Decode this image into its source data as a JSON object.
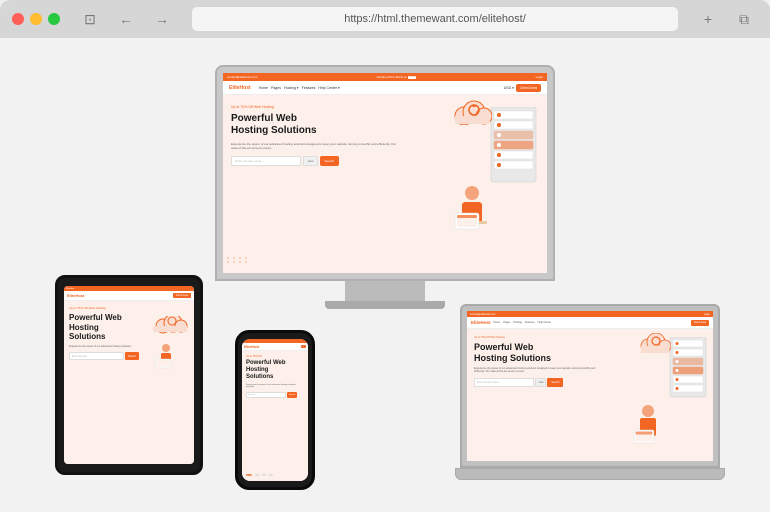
{
  "browser": {
    "url": "https://html.themewant.com/elitehost/",
    "back_label": "←",
    "forward_label": "→",
    "add_tab_label": "+",
    "duplicate_tab_label": "⧉",
    "sidebar_label": "⊡"
  },
  "site": {
    "topbar_text_left": "contact@elitehost.com",
    "topbar_text_middle": "Hosting Price Starts at",
    "topbar_badge": "$2.99",
    "topbar_right": "customercare",
    "login_label": "Login",
    "logo": "EliteHost",
    "nav_items": [
      "Home",
      "Pages",
      "Hosting",
      "Features",
      "Help Center"
    ],
    "nav_dropdown_label": "USD",
    "nav_cta": "Client Area",
    "hero_tag": "Up to 75% Off Web Hosting",
    "hero_title_line1": "Powerful Web",
    "hero_title_line2": "Hosting Solutions",
    "hero_desc": "Experience the power of our advanced hosting solutions designed to keep your website running smoothly and efficiently. Our state-of-the-art servers ensure",
    "search_placeholder": "Enter domain name...",
    "search_dropdown": ".com",
    "search_btn": "Search"
  },
  "devices": {
    "monitor_label": "Desktop Monitor",
    "tablet_label": "Tablet",
    "phone_label": "Mobile Phone",
    "laptop_label": "Laptop"
  }
}
